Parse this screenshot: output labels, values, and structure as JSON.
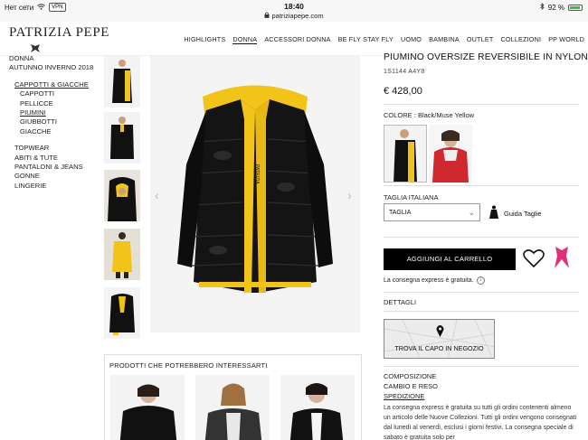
{
  "status_bar": {
    "carrier": "Нет сети",
    "vpn": "VPN",
    "time": "18:40",
    "url": "patriziapepe.com",
    "battery": "92 %",
    "battery_level": 0.92,
    "icons": [
      "wifi-icon",
      "lock-icon",
      "bluetooth-icon",
      "battery-icon"
    ]
  },
  "header": {
    "logo": "PATRIZIA PEPE",
    "nav": [
      {
        "label": "HIGHLIGHTS",
        "active": false
      },
      {
        "label": "DONNA",
        "active": true
      },
      {
        "label": "ACCESSORI DONNA",
        "active": false
      },
      {
        "label": "BE FLY STAY FLY",
        "active": false
      },
      {
        "label": "UOMO",
        "active": false
      },
      {
        "label": "BAMBINA",
        "active": false
      },
      {
        "label": "OUTLET",
        "active": false
      },
      {
        "label": "COLLEZIONI",
        "active": false
      },
      {
        "label": "PP WORLD",
        "active": false
      }
    ]
  },
  "sidebar": {
    "items": [
      {
        "label": "DONNA",
        "level": 0
      },
      {
        "label": "AUTUNNO INVERNO 2018",
        "level": 0
      },
      {
        "label": "CAPPOTTI & GIACCHE",
        "level": 1,
        "underline": true
      },
      {
        "label": "CAPPOTTI",
        "level": 2
      },
      {
        "label": "PELLICCE",
        "level": 2
      },
      {
        "label": "PIUMINI",
        "level": 2,
        "underline": true
      },
      {
        "label": "GIUBBOTTI",
        "level": 2
      },
      {
        "label": "GIACCHE",
        "level": 2
      },
      {
        "label": "TOPWEAR",
        "level": 1
      },
      {
        "label": "ABITI & TUTE",
        "level": 1
      },
      {
        "label": "PANTALONI & JEANS",
        "level": 1
      },
      {
        "label": "GONNE",
        "level": 1
      },
      {
        "label": "LINGERIE",
        "level": 1
      }
    ]
  },
  "product": {
    "title": "PIUMINO OVERSIZE REVERSIBILE IN NYLON",
    "code": "1S1144  A4Y8",
    "price": "€ 428,00",
    "color_label": "COLORE :",
    "color_value": "Black/Muse Yellow",
    "size_label": "TAGLIA ITALIANA",
    "size_select": "TAGLIA",
    "size_guide": "Guida Taglie",
    "add_to_cart": "AGGIUNGI AL CARRELLO",
    "express_note": "La consegna express è gratuita.",
    "details": "DETTAGLI",
    "store_button": "TROVA IL CAPO IN NEGOZIO",
    "accordion": [
      "COMPOSIZIONE",
      "CAMBIO E RESO",
      "SPEDIZIONE"
    ],
    "shipping_text": "La consegna express è gratuita su tutti gli ordini contenenti almeno un articolo delle Nuove Collezioni. Tutti gli ordini vengono consegnati dal lunedì al venerdì, esclusi i giorni festivi. La consegna speciale di sabato è gratuita solo per"
  },
  "related": {
    "title": "PRODOTTI CHE POTREBBERO INTERESSARTI"
  },
  "colors": {
    "yellow": "#f2c41a",
    "black": "#111111",
    "red": "#d0282f",
    "accent_pink": "#e0307a"
  }
}
